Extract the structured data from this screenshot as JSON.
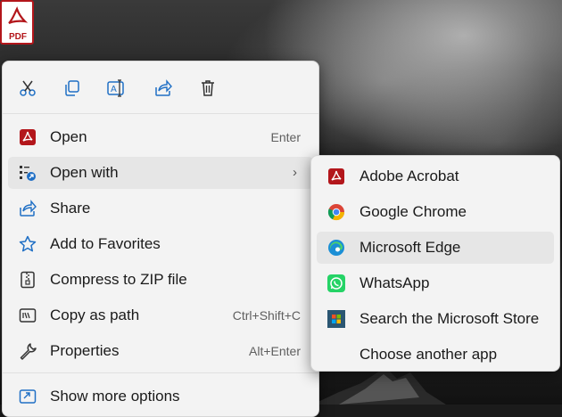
{
  "desktop": {
    "file_icon_label": "PDF",
    "file_caption": "..."
  },
  "context_menu": {
    "toolbar": [
      {
        "name": "cut-icon"
      },
      {
        "name": "copy-icon"
      },
      {
        "name": "rename-icon"
      },
      {
        "name": "share-icon"
      },
      {
        "name": "delete-icon"
      }
    ],
    "items": [
      {
        "label": "Open",
        "shortcut": "Enter",
        "icon": "acrobat-icon"
      },
      {
        "label": "Open with",
        "shortcut": "",
        "icon": "open-with-icon",
        "submenu_arrow": "›"
      },
      {
        "label": "Share",
        "shortcut": "",
        "icon": "share-icon"
      },
      {
        "label": "Add to Favorites",
        "shortcut": "",
        "icon": "star-icon"
      },
      {
        "label": "Compress to ZIP file",
        "shortcut": "",
        "icon": "zip-icon"
      },
      {
        "label": "Copy as path",
        "shortcut": "Ctrl+Shift+C",
        "icon": "copy-path-icon"
      },
      {
        "label": "Properties",
        "shortcut": "Alt+Enter",
        "icon": "wrench-icon"
      },
      {
        "label": "Show more options",
        "shortcut": "",
        "icon": "more-options-icon"
      }
    ]
  },
  "open_with_submenu": {
    "items": [
      {
        "label": "Adobe Acrobat",
        "icon": "acrobat-icon"
      },
      {
        "label": "Google Chrome",
        "icon": "chrome-icon"
      },
      {
        "label": "Microsoft Edge",
        "icon": "edge-icon",
        "highlighted": true
      },
      {
        "label": "WhatsApp",
        "icon": "whatsapp-icon"
      },
      {
        "label": "Search the Microsoft Store",
        "icon": "store-icon"
      },
      {
        "label": "Choose another app",
        "icon": ""
      }
    ]
  },
  "colors": {
    "menu_bg": "#f3f3f3",
    "hover_bg": "#e6e6e6",
    "icon_blue": "#1f6fc5",
    "acrobat_red": "#b3161b"
  }
}
